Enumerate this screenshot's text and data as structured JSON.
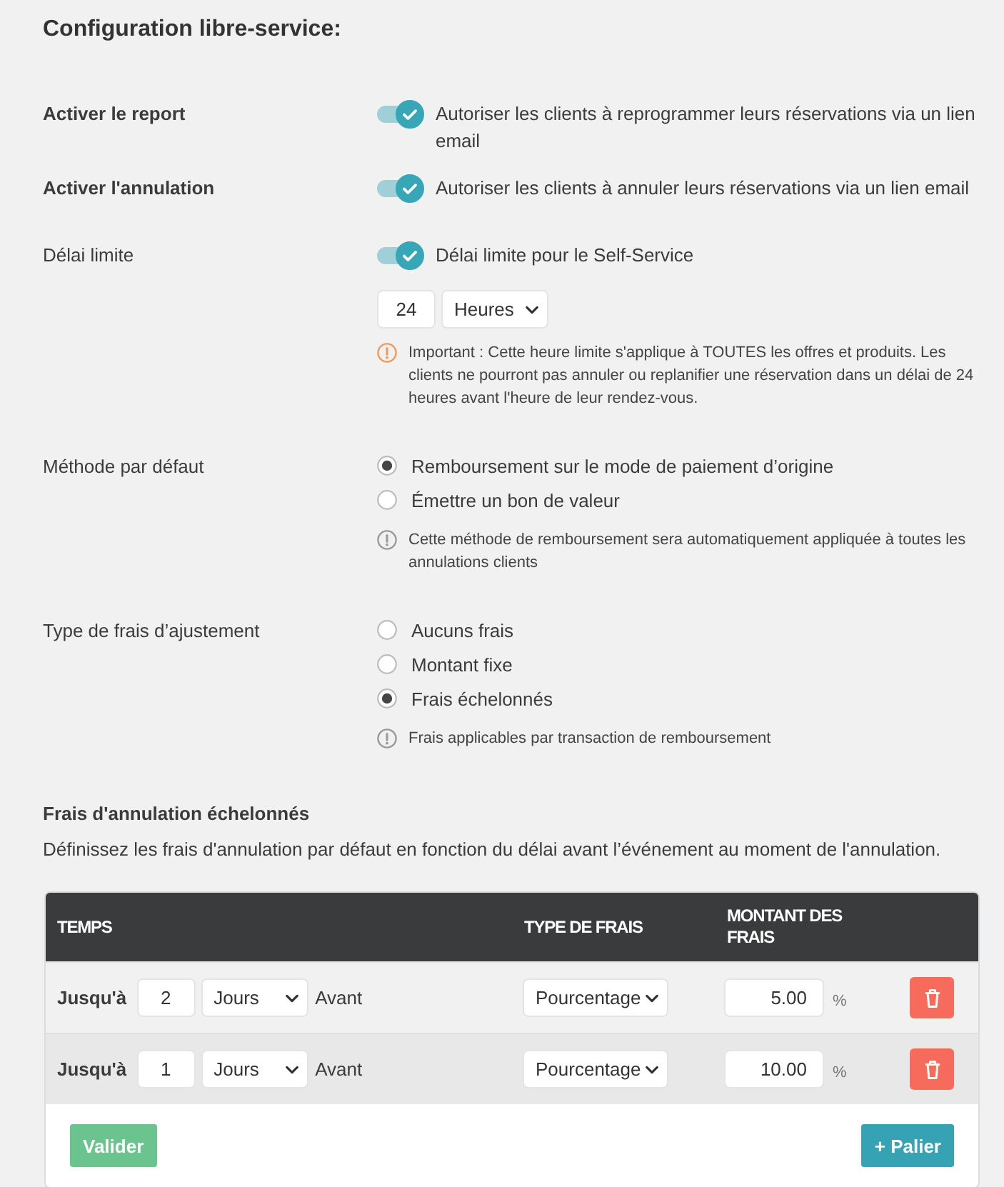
{
  "title": "Configuration libre-service:",
  "settings": [
    {
      "kind": "toggle",
      "label": "Activer le report",
      "strong": true,
      "on": true,
      "text": "Autoriser les clients à reprogrammer leurs réservations via un lien email"
    },
    {
      "kind": "toggle",
      "label": "Activer l'annulation",
      "strong": true,
      "on": true,
      "text": "Autoriser les clients à annuler leurs réservations via un lien email"
    },
    {
      "kind": "toggle",
      "label": "Délai limite",
      "strong": false,
      "on": true,
      "text": "Délai limite pour le Self-Service",
      "amount": "24",
      "unit": "Heures",
      "note": {
        "kind": "warning",
        "text": "Important : Cette heure limite s'applique à TOUTES les offres et produits. Les clients ne pourront pas annuler ou replanifier une réservation dans un délai de 24 heures avant l'heure de leur rendez-vous."
      }
    },
    {
      "kind": "radio",
      "label": "Méthode par défaut",
      "strong": false,
      "options": [
        {
          "label": "Remboursement sur le mode de paiement d’origine",
          "selected": true
        },
        {
          "label": "Émettre un bon de valeur",
          "selected": false
        }
      ],
      "note": {
        "kind": "info",
        "text": "Cette méthode de remboursement sera automatiquement appliquée à toutes les annulations clients"
      }
    },
    {
      "kind": "radio",
      "label": "Type de frais d’ajustement",
      "strong": false,
      "options": [
        {
          "label": "Aucuns frais",
          "selected": false
        },
        {
          "label": "Montant fixe",
          "selected": false
        },
        {
          "label": "Frais échelonnés",
          "selected": true
        }
      ],
      "note": {
        "kind": "info",
        "text": "Frais applicables par transaction de remboursement"
      }
    }
  ],
  "tiered_fees": {
    "title": "Frais d'annulation échelonnés",
    "description": "Définissez les frais d'annulation par défaut en fonction du délai avant l’événement au moment de l'annulation.",
    "table": {
      "columns": [
        "TEMPS",
        "TYPE DE FRAIS",
        "MONTANT DES FRAIS"
      ],
      "rows": [
        {
          "prefix": "Jusqu'à",
          "count": "2",
          "unit": "Jours",
          "suffix": "Avant",
          "fee_type": "Pourcentage",
          "amount": "5.00",
          "amount_unit": "%"
        },
        {
          "prefix": "Jusqu'à",
          "count": "1",
          "unit": "Jours",
          "suffix": "Avant",
          "fee_type": "Pourcentage",
          "amount": "10.00",
          "amount_unit": "%"
        }
      ]
    },
    "buttons": [
      {
        "kind": "submit",
        "label": "Valider"
      },
      {
        "kind": "add",
        "label": "+ Palier"
      }
    ]
  }
}
